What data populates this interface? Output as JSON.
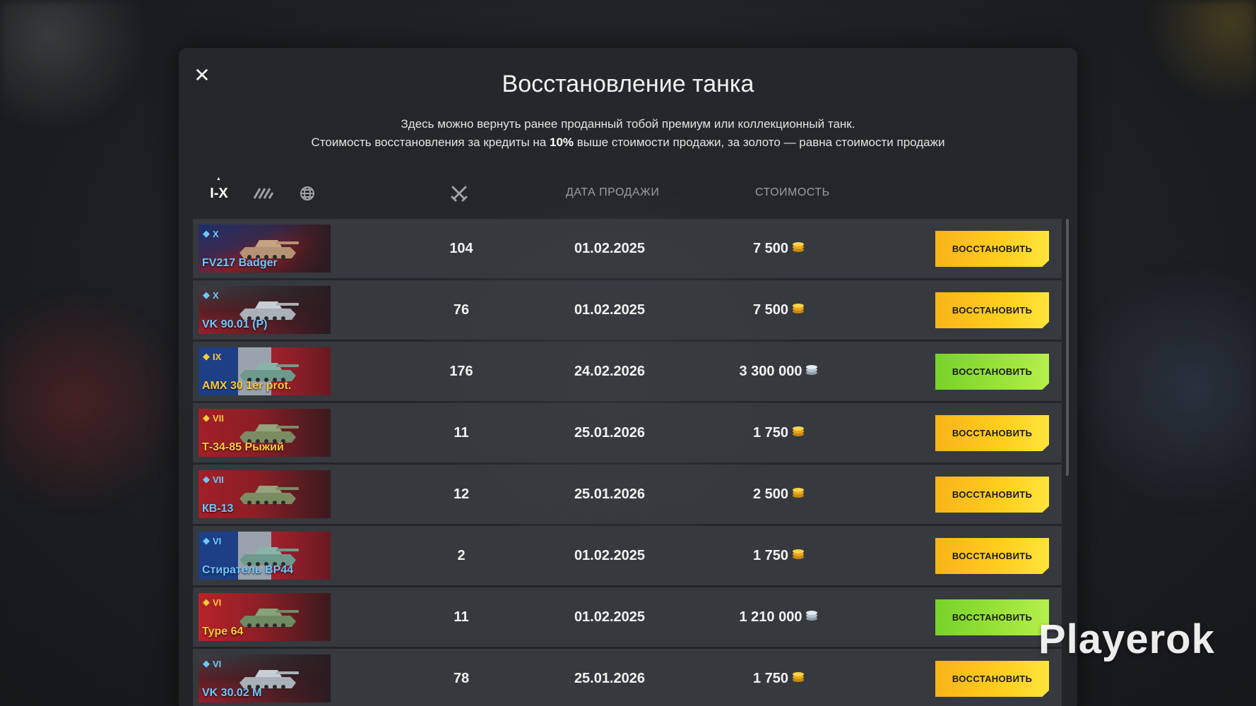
{
  "dialog": {
    "title": "Восстановление танка",
    "subtitle_line1": "Здесь можно вернуть ранее проданный тобой премиум или коллекционный танк.",
    "subtitle_line2_a": "Стоимость восстановления за кредиты на ",
    "subtitle_line2_b": "10%",
    "subtitle_line2_c": " выше стоимости продажи, за золото — равна стоимости продажи",
    "close_icon": "close-icon"
  },
  "filters": {
    "tier_label": "I-X",
    "type_icon": "vehicle-class-icon",
    "nation_icon": "globe-icon"
  },
  "columns": {
    "battles_icon": "crossed-swords-icon",
    "date": "ДАТА ПРОДАЖИ",
    "cost": "СТОИМОСТЬ"
  },
  "currency_colors": {
    "gold": "#f5b820",
    "credits": "#c9d4dc"
  },
  "rows": [
    {
      "name": "FV217 Badger",
      "tier": "X",
      "name_color": "blue",
      "flag": "uk",
      "battles": "104",
      "date": "01.02.2025",
      "cost": "7 500",
      "currency": "gold",
      "button": "ВОССТАНОВИТЬ",
      "button_style": "gold"
    },
    {
      "name": "VK 90.01 (P)",
      "tier": "X",
      "name_color": "blue",
      "flag": "germany",
      "battles": "76",
      "date": "01.02.2025",
      "cost": "7 500",
      "currency": "gold",
      "button": "ВОССТАНОВИТЬ",
      "button_style": "gold"
    },
    {
      "name": "AMX 30 1er prot.",
      "tier": "IX",
      "name_color": "gold",
      "flag": "france",
      "battles": "176",
      "date": "24.02.2026",
      "cost": "3 300 000",
      "currency": "credits",
      "button": "ВОССТАНОВИТЬ",
      "button_style": "green"
    },
    {
      "name": "Т-34-85 Рыжий",
      "tier": "VII",
      "name_color": "gold",
      "flag": "ussr",
      "battles": "11",
      "date": "25.01.2026",
      "cost": "1 750",
      "currency": "gold",
      "button": "ВОССТАНОВИТЬ",
      "button_style": "gold"
    },
    {
      "name": "КВ-13",
      "tier": "VII",
      "name_color": "blue",
      "flag": "ussr",
      "battles": "12",
      "date": "25.01.2026",
      "cost": "2 500",
      "currency": "gold",
      "button": "ВОССТАНОВИТЬ",
      "button_style": "gold"
    },
    {
      "name": "Стиратель BP44",
      "tier": "VI",
      "name_color": "blue",
      "flag": "france",
      "battles": "2",
      "date": "01.02.2025",
      "cost": "1 750",
      "currency": "gold",
      "button": "ВОССТАНОВИТЬ",
      "button_style": "gold"
    },
    {
      "name": "Type 64",
      "tier": "VI",
      "name_color": "gold",
      "flag": "china",
      "battles": "11",
      "date": "01.02.2025",
      "cost": "1 210 000",
      "currency": "credits",
      "button": "ВОССТАНОВИТЬ",
      "button_style": "green"
    },
    {
      "name": "VK 30.02 M",
      "tier": "VI",
      "name_color": "blue",
      "flag": "germany",
      "battles": "78",
      "date": "25.01.2026",
      "cost": "1 750",
      "currency": "gold",
      "button": "ВОССТАНОВИТЬ",
      "button_style": "gold"
    }
  ],
  "watermark": "Playerok"
}
